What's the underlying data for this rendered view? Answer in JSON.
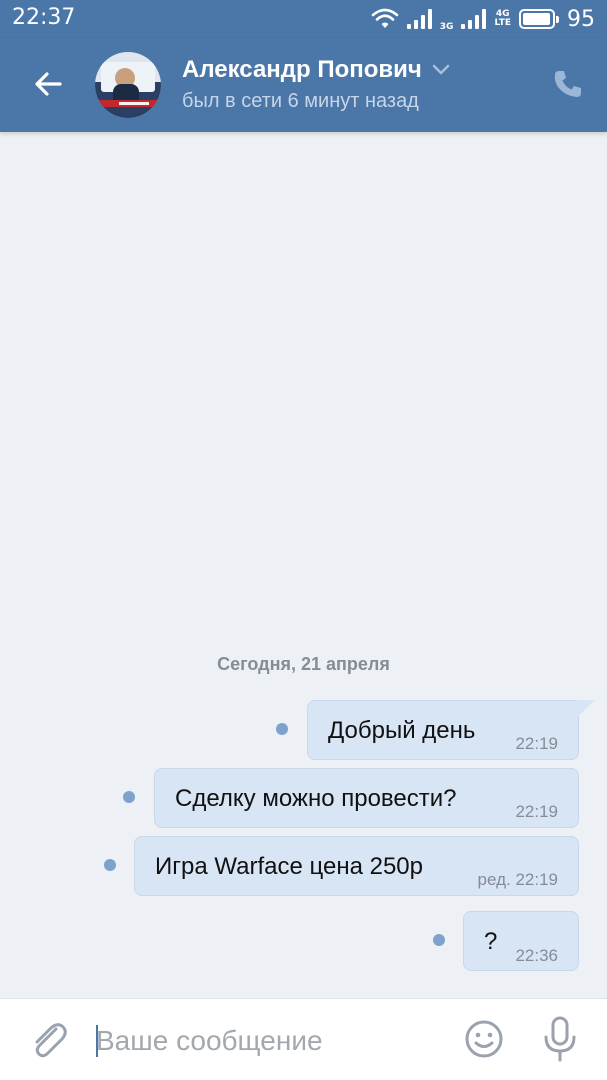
{
  "status_bar": {
    "time": "22:37",
    "network_1": "3G",
    "network_2_top": "4G",
    "network_2_bottom": "LTE",
    "battery_level": 0.95,
    "battery_pct": "95"
  },
  "header": {
    "contact_name": "Александр Попович",
    "status": "был в сети 6 минут назад",
    "icons": [
      "back-arrow-icon",
      "chevron-down-icon",
      "phone-icon"
    ],
    "colors": {
      "bar": "#4a76a8",
      "subtitle": "#c6d5e8"
    }
  },
  "chat": {
    "date_separator": "Сегодня, 21 апреля",
    "messages": [
      {
        "text": "Добрый день",
        "meta": "22:19",
        "unread": true
      },
      {
        "text": "Сделку можно провести?",
        "meta": "22:19",
        "unread": true
      },
      {
        "text": "Игра Warface цена 250р",
        "meta": "ред. 22:19",
        "unread": true
      },
      {
        "text": "?",
        "meta": "22:36",
        "unread": true
      }
    ],
    "colors": {
      "bubble": "#d8e5f5",
      "unread_dot": "#7ea2cd",
      "background": "#edf0f4"
    }
  },
  "composer": {
    "placeholder": "Ваше сообщение",
    "icons": [
      "paperclip-icon",
      "smile-icon",
      "microphone-icon"
    ]
  }
}
